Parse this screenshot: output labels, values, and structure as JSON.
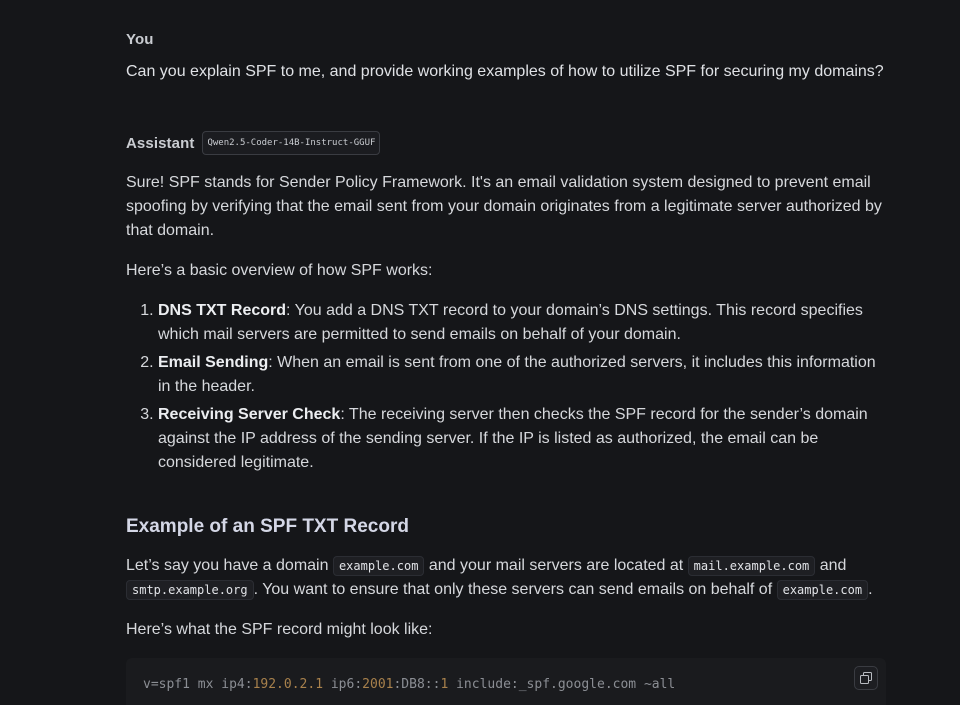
{
  "user_message": {
    "role": "You",
    "text": "Can you explain SPF to me, and provide working examples of how to utilize SPF for securing my domains?"
  },
  "assistant_message": {
    "role": "Assistant",
    "model_badge": "Qwen2.5-Coder-14B-Instruct-GGUF",
    "intro": "Sure! SPF stands for Sender Policy Framework. It's an email validation system designed to prevent email spoofing by verifying that the email sent from your domain originates from a legitimate server authorized by that domain.",
    "overview_lead": "Here’s a basic overview of how SPF works:",
    "steps": [
      {
        "title": "DNS TXT Record",
        "text": ": You add a DNS TXT record to your domain’s DNS settings. This record specifies which mail servers are permitted to send emails on behalf of your domain."
      },
      {
        "title": "Email Sending",
        "text": ": When an email is sent from one of the authorized servers, it includes this information in the header."
      },
      {
        "title": "Receiving Server Check",
        "text": ": The receiving server then checks the SPF record for the sender’s domain against the IP address of the sending server. If the IP is listed as authorized, the email can be considered legitimate."
      }
    ],
    "example_heading": "Example of an SPF TXT Record",
    "example_para": {
      "t1": "Let’s say you have a domain ",
      "c1": "example.com",
      "t2": " and your mail servers are located at ",
      "c2": "mail.example.com",
      "t3": " and ",
      "c3": "smtp.example.org",
      "t4": ". You want to ensure that only these servers can send emails on behalf of ",
      "c4": "example.com",
      "t5": "."
    },
    "record_lead": "Here’s what the SPF record might look like:",
    "code": {
      "p1": "v=spf1 mx ip4:",
      "n1": "192.0.2.1",
      "p2": " ip6:",
      "n2": "2001",
      "p3": ":DB8::",
      "n3": "1",
      "p4": " include:_spf.google.com ~all"
    }
  },
  "icons": {
    "copy": "copy-icon"
  }
}
